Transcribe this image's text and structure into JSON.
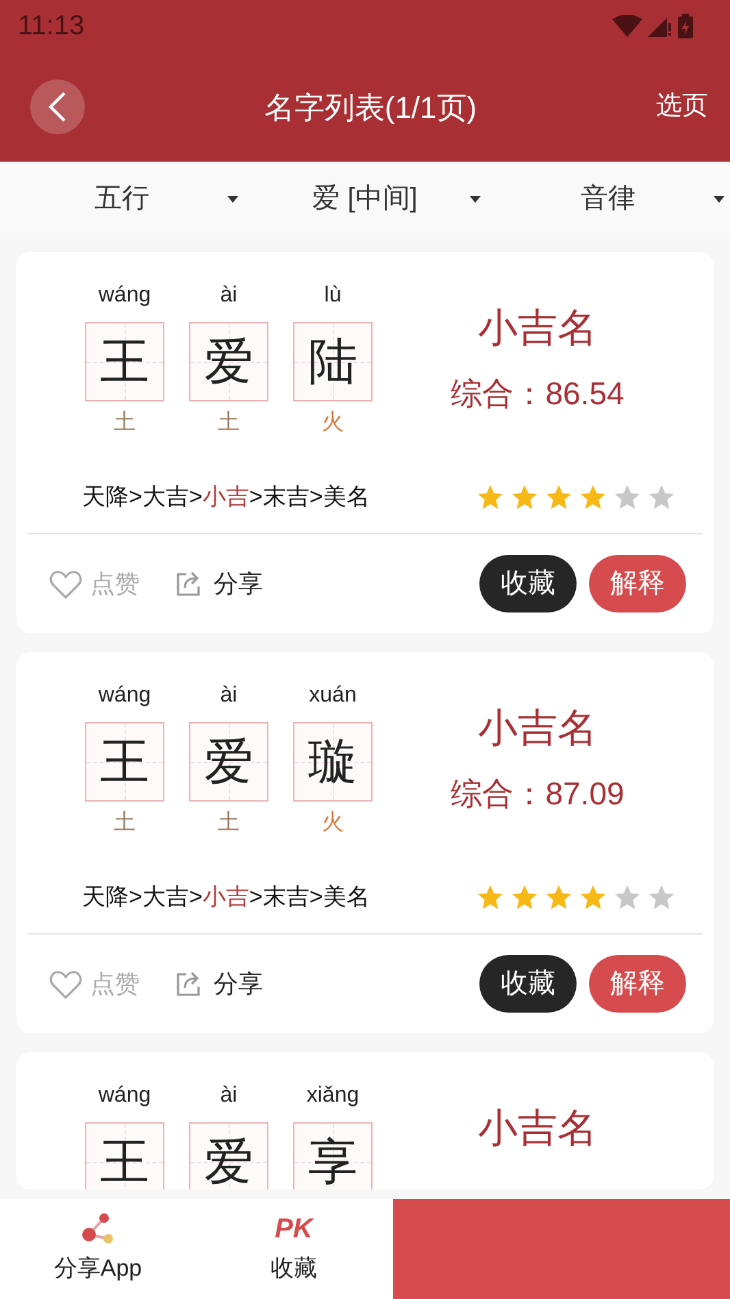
{
  "status_bar": {
    "time": "11:13"
  },
  "header": {
    "title": "名字列表(1/1页)",
    "action": "选页"
  },
  "filters": [
    {
      "label": "五行"
    },
    {
      "label": "爱 [中间]"
    },
    {
      "label": "音律"
    }
  ],
  "cards": [
    {
      "chars": [
        {
          "pinyin": "wáng",
          "char": "王",
          "element": "土",
          "color": "#9a7a5e"
        },
        {
          "pinyin": "ài",
          "char": "爱",
          "element": "土",
          "color": "#9a7a5e"
        },
        {
          "pinyin": "lù",
          "char": "陆",
          "element": "火",
          "color": "#d9773a"
        }
      ],
      "grade": "小吉名",
      "score": "综合：86.54",
      "scale": [
        {
          "label": "天降",
          "selected": false
        },
        {
          "label": "大吉",
          "selected": false
        },
        {
          "label": "小吉",
          "selected": true
        },
        {
          "label": "末吉",
          "selected": false
        },
        {
          "label": "美名",
          "selected": false
        }
      ],
      "scale_separator": ">",
      "stars": 4,
      "like": {
        "label": "点赞",
        "liked": false
      },
      "share": "分享",
      "buttons": [
        "收藏",
        "解释"
      ]
    },
    {
      "chars": [
        {
          "pinyin": "wáng",
          "char": "王",
          "element": "土",
          "color": "#9a7a5e"
        },
        {
          "pinyin": "ài",
          "char": "爱",
          "element": "土",
          "color": "#9a7a5e"
        },
        {
          "pinyin": "xuán",
          "char": "璇",
          "element": "火",
          "color": "#d9773a"
        }
      ],
      "grade": "小吉名",
      "score": "综合：87.09",
      "scale": [
        {
          "label": "天降",
          "selected": false
        },
        {
          "label": "大吉",
          "selected": false
        },
        {
          "label": "小吉",
          "selected": true
        },
        {
          "label": "末吉",
          "selected": false
        },
        {
          "label": "美名",
          "selected": false
        }
      ],
      "scale_separator": ">",
      "stars": 4,
      "like": {
        "label": "点赞",
        "liked": false
      },
      "share": "分享",
      "buttons": [
        "收藏",
        "解释"
      ]
    },
    {
      "chars": [
        {
          "pinyin": "wáng",
          "char": "王"
        },
        {
          "pinyin": "ài",
          "char": "爱"
        },
        {
          "pinyin": "xiǎng",
          "char": "享"
        }
      ],
      "grade": "小吉名"
    }
  ],
  "bottom_bar": {
    "items": [
      {
        "kind": "share",
        "label": "分享App"
      },
      {
        "kind": "pk",
        "label": "收藏",
        "icon_text": "PK"
      }
    ]
  }
}
